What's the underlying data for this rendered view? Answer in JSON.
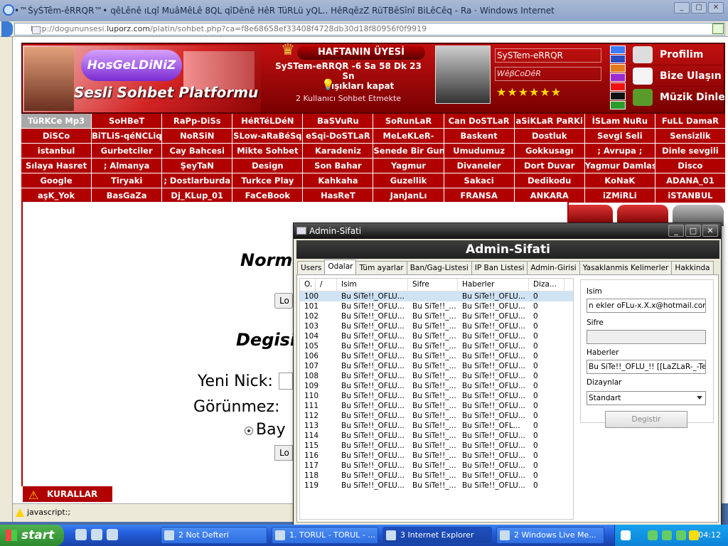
{
  "browser": {
    "title": "•™ŠyŠTêm-êRRQR™• qêLênê ıLqî MuâMêLê 8QL qîDênê HêR TüRLü yQL.. HêRqêzZ RüTBêSînî BiLêCêq - Ra · Windows Internet Explorer",
    "address_prefix": "http://dogununsesi.",
    "address_domain": "luporz.com",
    "address_path": "/platin/sohbet.php?ca=f8e68658ef33408f4728db30d18f80956f0f9919",
    "status_text": "javascript:;"
  },
  "banner": {
    "welcome": "HosGeLDiNiZ",
    "platform": "Sesli Sohbet Platformu",
    "week_title": "HAFTANIN ÜYESİ",
    "week_member": "SySTem-eRRQR -6 Sa 58 Dk 23 Sn",
    "lights_off": "ışıkları kapat",
    "online_count": "2",
    "online_text": "Kullanıcı Sohbet Etmekte",
    "member_name": "SySTem-eRRQR",
    "member_sub": "WêβCoDêR",
    "stars": "★★★★★★",
    "link_profile": "Profilim",
    "link_contact": "Bize Ulaşın",
    "link_music": "Müzik Dinle"
  },
  "rooms": [
    "TüRKCe Mp3",
    "SoHBeT",
    "RaPp-DiSs",
    "HéRTéLDéN",
    "BaSVuRu",
    "SoRunLaR",
    "Can DoSTLaR",
    "aSiKLaR PaRKi",
    "İSLam NuRu",
    "FuLL DamaR",
    "DiSCo",
    "BiTLiS-qéNCLiq",
    "NoRSiN",
    "SLow-aRaBéSq",
    "eSqi-DoSTLaR",
    "MeLeKLeR-",
    "Baskent",
    "Dostluk",
    "Sevgi Seli",
    "Sensizlik",
    "istanbul",
    "Gurbetciler",
    "Cay Bahcesi",
    "Mikte Sohbet",
    "Karadeniz",
    "Senede Bir Gun",
    "Umudumuz",
    "Gokkusagı",
    "; Avrupa ;",
    "Dinle sevgili",
    "Sılaya Hasret",
    "; Almanya",
    "ŞeyTaN",
    "Design",
    "Son Bahar",
    "Yagmur",
    "Divaneler",
    "Dort Duvar",
    "Yagmur Damlası",
    "Disco",
    "Google",
    "Tiryaki",
    "; Dostlarburda",
    "Turkce Play",
    "Kahkaha",
    "Guzellik",
    "Sakaci",
    "Dedikodu",
    "KoNaK",
    "ADANA_01",
    "aşK_Yok",
    "BasGaZa",
    "Dj_KLup_01",
    "FaCeBook",
    "HasReT",
    "JanJanLı",
    "FRANSA",
    "ANKARA",
    "iZMiRLi",
    "iSTANBUL"
  ],
  "page": {
    "normal_heading": "Norma",
    "login_btn": "Lo",
    "degis_heading": "Degisi",
    "new_nick_label": "Yeni Nick:",
    "invisible_label": "Görünmez:",
    "gender_label": "Bay",
    "login_btn2": "Lo",
    "rules": "KURALLAR"
  },
  "dialog": {
    "title": "Admin-Sifati",
    "header": "Admin-Sifati",
    "tabs": [
      "Users",
      "Odalar",
      "Tüm ayarlar",
      "Ban/Gag-Listesi",
      "IP Ban Listesi",
      "Admin-Girisi",
      "Yasaklanmis Kelimerler",
      "Hakkinda"
    ],
    "columns": [
      "O.",
      "/",
      "Isim",
      "Sifre",
      "Haberler",
      "Diza..."
    ],
    "rows": [
      [
        "100",
        "Bu SiTe!!_OFLU...",
        "",
        "Bu SiTe!!_OFLU...",
        "0"
      ],
      [
        "101",
        "Bu SiTe!!_OFLU...",
        "Bu SiTe!!_...",
        "Bu SiTe!!_OFLU...",
        "0"
      ],
      [
        "102",
        "Bu SiTe!!_OFLU...",
        "Bu SiTe!!_...",
        "Bu SiTe!!_OFLU...",
        "0"
      ],
      [
        "103",
        "Bu SiTe!!_OFLU...",
        "Bu SiTe!!_...",
        "Bu SiTe!!_OFLU...",
        "0"
      ],
      [
        "104",
        "Bu SiTe!!_OFLU...",
        "Bu SiTe!!_...",
        "Bu SiTe!!_OFLU...",
        "0"
      ],
      [
        "105",
        "Bu SiTe!!_OFLU...",
        "Bu SiTe!!_...",
        "Bu SiTe!!_OFLU...",
        "0"
      ],
      [
        "106",
        "Bu SiTe!!_OFLU...",
        "Bu SiTe!!_...",
        "Bu SiTe!!_OFLU...",
        "0"
      ],
      [
        "107",
        "Bu SiTe!!_OFLU...",
        "Bu SiTe!!_...",
        "Bu SiTe!!_OFLU...",
        "0"
      ],
      [
        "108",
        "Bu SiTe!!_OFLU...",
        "Bu SiTe!!_...",
        "Bu SiTe!!_OFLU...",
        "0"
      ],
      [
        "109",
        "Bu SiTe!!_OFLU...",
        "Bu SiTe!!_...",
        "Bu SiTe!!_OFLU...",
        "0"
      ],
      [
        "110",
        "Bu SiTe!!_OFLU...",
        "Bu SiTe!!_...",
        "Bu SiTe!!_OFLU...",
        "0"
      ],
      [
        "111",
        "Bu SiTe!!_OFLU...",
        "Bu SiTe!!_...",
        "Bu SiTe!!_OFLU...",
        "0"
      ],
      [
        "112",
        "Bu SiTe!!_OFLU...",
        "Bu SiTe!!_...",
        "Bu SiTe!!_OFLU...",
        "0"
      ],
      [
        "113",
        "Bu SiTe!!_OFLU...",
        "Bu SiTe!!_...",
        "Bu SiTe!!_OFL...",
        "0"
      ],
      [
        "114",
        "Bu SiTe!!_OFLU...",
        "Bu SiTe!!_...",
        "Bu SiTe!!_OFLU...",
        "0"
      ],
      [
        "115",
        "Bu SiTe!!_OFLU...",
        "Bu SiTe!!_...",
        "Bu SiTe!!_OFLU...",
        "0"
      ],
      [
        "116",
        "Bu SiTe!!_OFLU...",
        "Bu SiTe!!_...",
        "Bu SiTe!!_OFLU...",
        "0"
      ],
      [
        "117",
        "Bu SiTe!!_OFLU...",
        "Bu SiTe!!_...",
        "Bu SiTe!!_OFLU...",
        "0"
      ],
      [
        "118",
        "Bu SiTe!!_OFLU...",
        "Bu SiTe!!_...",
        "Bu SiTe!!_OFLU...",
        "0"
      ],
      [
        "119",
        "Bu SiTe!!_OFLU...",
        "Bu SiTe!!_...",
        "Bu SiTe!!_OFLU...",
        "0"
      ]
    ],
    "form": {
      "isim_label": "Isim",
      "isim_value": "n ekler oFLu-x.X.x@hotmail.com>",
      "sifre_label": "Sifre",
      "sifre_value": "",
      "haberler_label": "Haberler",
      "haberler_value": "Bu SiTe!!_OFLU_!! [[LaZLaR-_-Tea",
      "dizayn_label": "Dizaynlar",
      "dizayn_value": "Standart",
      "save_btn": "Degistir"
    }
  },
  "taskbar": {
    "start": "start",
    "items": [
      "2 Not Defteri",
      "1. TORUL - TORUL - ...",
      "3 Internet Explorer",
      "2 Windows Live Me..."
    ],
    "clock": "04:12"
  }
}
